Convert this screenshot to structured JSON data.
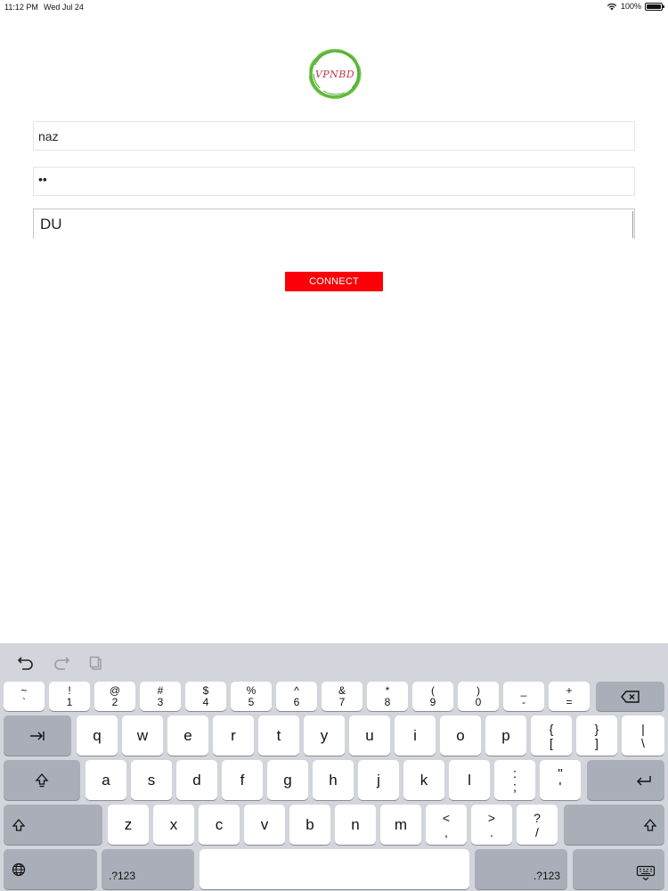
{
  "status_bar": {
    "time": "11:12 PM",
    "date": "Wed Jul 24",
    "battery": "100%",
    "battery_level": 1.0
  },
  "logo": {
    "text": "VPNBD"
  },
  "form": {
    "username_value": "naz",
    "password_value": "••",
    "server_value": "DU",
    "connect_label": "CONNECT"
  },
  "colors": {
    "connect_bg": "#fb0007",
    "logo_ring": "#5cb83a",
    "logo_text": "#c0364a"
  },
  "keyboard": {
    "toolbar": [
      "undo-icon",
      "redo-icon",
      "paste-icon"
    ],
    "row1": [
      {
        "top": "~",
        "bottom": "`"
      },
      {
        "top": "!",
        "bottom": "1"
      },
      {
        "top": "@",
        "bottom": "2"
      },
      {
        "top": "#",
        "bottom": "3"
      },
      {
        "top": "$",
        "bottom": "4"
      },
      {
        "top": "%",
        "bottom": "5"
      },
      {
        "top": "^",
        "bottom": "6"
      },
      {
        "top": "&",
        "bottom": "7"
      },
      {
        "top": "*",
        "bottom": "8"
      },
      {
        "top": "(",
        "bottom": "9"
      },
      {
        "top": ")",
        "bottom": "0"
      },
      {
        "top": "_",
        "bottom": "-"
      },
      {
        "top": "+",
        "bottom": "="
      }
    ],
    "row2": [
      "q",
      "w",
      "e",
      "r",
      "t",
      "y",
      "u",
      "i",
      "o",
      "p"
    ],
    "row2_sym": [
      {
        "top": "{",
        "bottom": "["
      },
      {
        "top": "}",
        "bottom": "]"
      },
      {
        "top": "|",
        "bottom": "\\"
      }
    ],
    "row3": [
      "a",
      "s",
      "d",
      "f",
      "g",
      "h",
      "j",
      "k",
      "l"
    ],
    "row3_sym": [
      {
        "top": ":",
        "bottom": ";"
      },
      {
        "top": "\"",
        "bottom": "'"
      }
    ],
    "row4": [
      "z",
      "x",
      "c",
      "v",
      "b",
      "n",
      "m"
    ],
    "row4_sym": [
      {
        "top": "<",
        "bottom": ","
      },
      {
        "top": ">",
        "bottom": "."
      },
      {
        "top": "?",
        "bottom": "/"
      }
    ],
    "numbers_label": ".?123",
    "numbers_label_right": ".?123"
  }
}
